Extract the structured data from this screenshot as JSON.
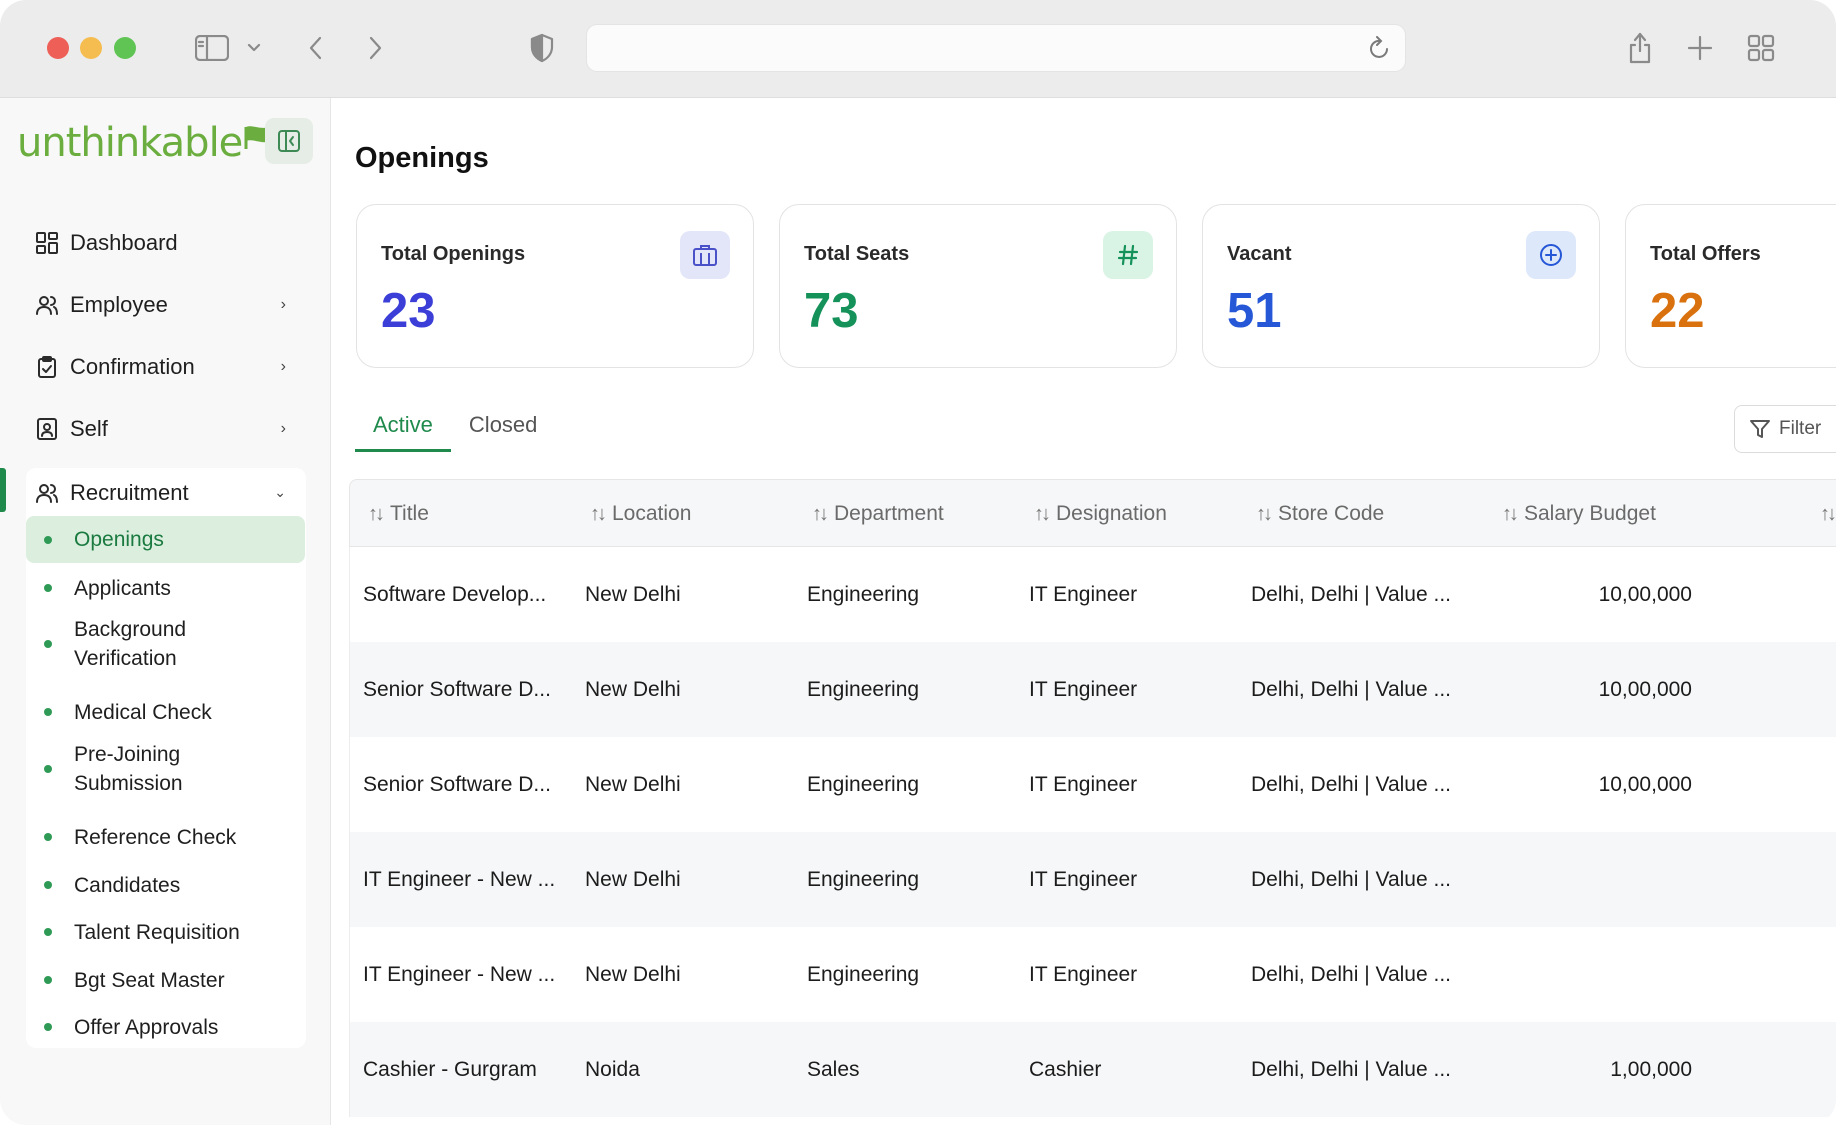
{
  "browser": {
    "traffic_colors": [
      "#ed5f57",
      "#f5bd4f",
      "#5fc454"
    ],
    "url": ""
  },
  "sidebar": {
    "logo_text": "unthinkable",
    "nav": [
      {
        "label": "Dashboard",
        "icon": "grid-icon",
        "has_chevron": false
      },
      {
        "label": "Employee",
        "icon": "users-icon",
        "has_chevron": true
      },
      {
        "label": "Confirmation",
        "icon": "clipboard-check-icon",
        "has_chevron": true
      },
      {
        "label": "Self",
        "icon": "id-card-icon",
        "has_chevron": true
      },
      {
        "label": "Recruitment",
        "icon": "users-icon",
        "has_chevron": true,
        "expanded": true
      }
    ],
    "recruitment_items": [
      {
        "label": "Openings",
        "selected": true
      },
      {
        "label": "Applicants"
      },
      {
        "label": "Background Verification"
      },
      {
        "label": "Medical Check"
      },
      {
        "label": "Pre-Joining Submission"
      },
      {
        "label": "Reference Check"
      },
      {
        "label": "Candidates"
      },
      {
        "label": "Talent Requisition"
      },
      {
        "label": "Bgt Seat Master"
      },
      {
        "label": "Offer Approvals"
      }
    ]
  },
  "page": {
    "title": "Openings"
  },
  "stats": [
    {
      "label": "Total Openings",
      "value": "23",
      "color": "#3b3fd8",
      "icon": "briefcase-icon",
      "badge_bg": "#e3e6f8"
    },
    {
      "label": "Total Seats",
      "value": "73",
      "color": "#15925a",
      "icon": "hash-icon",
      "badge_bg": "#d9f3e4"
    },
    {
      "label": "Vacant",
      "value": "51",
      "color": "#2557d6",
      "icon": "plus-circle-icon",
      "badge_bg": "#dde8fa"
    },
    {
      "label": "Total Offers",
      "value": "22",
      "color": "#d9720e"
    }
  ],
  "tabs": [
    {
      "label": "Active",
      "active": true
    },
    {
      "label": "Closed",
      "active": false
    }
  ],
  "filter_label": "Filter",
  "table": {
    "columns": [
      "Title",
      "Location",
      "Department",
      "Designation",
      "Store Code",
      "Salary Budget"
    ],
    "rows": [
      [
        "Software Develop...",
        "New Delhi",
        "Engineering",
        "IT Engineer",
        "Delhi, Delhi | Value ...",
        "10,00,000"
      ],
      [
        "Senior Software D...",
        "New Delhi",
        "Engineering",
        "IT Engineer",
        "Delhi, Delhi | Value ...",
        "10,00,000"
      ],
      [
        "Senior Software D...",
        "New Delhi",
        "Engineering",
        "IT Engineer",
        "Delhi, Delhi | Value ...",
        "10,00,000"
      ],
      [
        "IT Engineer - New ...",
        "New Delhi",
        "Engineering",
        "IT Engineer",
        "Delhi, Delhi | Value ...",
        ""
      ],
      [
        "IT Engineer - New ...",
        "New Delhi",
        "Engineering",
        "IT Engineer",
        "Delhi, Delhi | Value ...",
        ""
      ],
      [
        "Cashier - Gurgram",
        "Noida",
        "Sales",
        "Cashier",
        "Delhi, Delhi | Value ...",
        "1,00,000"
      ]
    ]
  }
}
